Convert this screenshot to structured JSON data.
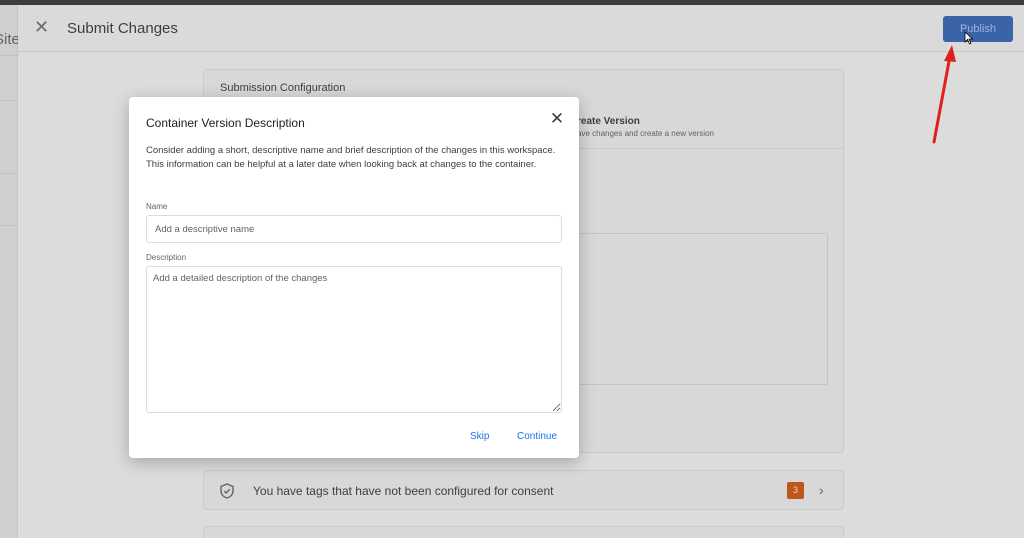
{
  "sidebar": {
    "truncated_label": "Site"
  },
  "header": {
    "close_glyph": "✕",
    "title": "Submit Changes",
    "publish_label": "Publish"
  },
  "submission": {
    "title": "Submission Configuration",
    "option_title": "reate Version",
    "option_subtitle": "ave changes and create a new version"
  },
  "consent": {
    "text": "You have tags that have not been configured for consent",
    "count": "3",
    "chevron_glyph": "›"
  },
  "modal": {
    "title": "Container Version Description",
    "close_glyph": "✕",
    "description": "Consider adding a short, descriptive name and brief description of the changes in this workspace. This information can be helpful at a later date when looking back at changes to the container.",
    "name_label": "Name",
    "name_placeholder": "Add a descriptive name",
    "description_label": "Description",
    "description_placeholder": "Add a detailed description of the changes",
    "skip_label": "Skip",
    "continue_label": "Continue"
  },
  "icons": {
    "close": "close-icon",
    "shield": "shield-icon",
    "chevron": "chevron-right-icon",
    "cursor": "mouse-cursor-icon",
    "arrow": "red-arrow-annotation"
  },
  "colors": {
    "accent": "#1a73e8",
    "publish_bg": "#3a63a8",
    "badge": "#c0561a",
    "arrow": "#e0201a"
  }
}
